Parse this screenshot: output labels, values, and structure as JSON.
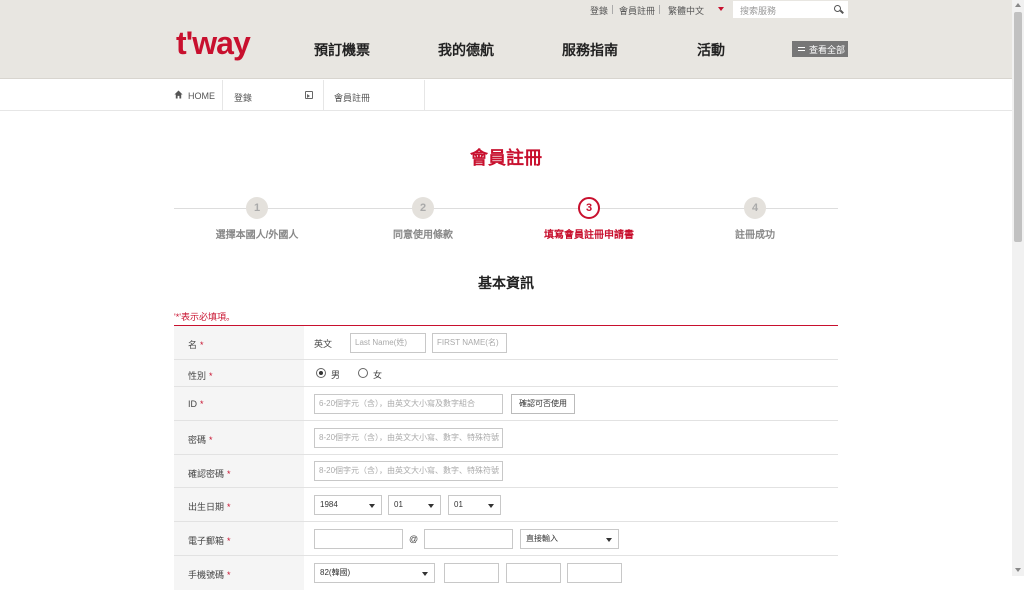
{
  "topbar": {
    "login": "登錄",
    "signup": "會員註冊",
    "language": "繁體中文",
    "search_placeholder": "搜索服務"
  },
  "header": {
    "logo": "t'way",
    "nav": [
      "預訂機票",
      "我的德航",
      "服務指南",
      "活動"
    ],
    "view_all": "查看全部"
  },
  "breadcrumb": {
    "home": "HOME",
    "level1": "登錄",
    "level2": "會員註冊"
  },
  "page_title": "會員註冊",
  "steps": [
    {
      "num": "1",
      "label": "選擇本國人/外國人",
      "active": false
    },
    {
      "num": "2",
      "label": "同意使用條款",
      "active": false
    },
    {
      "num": "3",
      "label": "填寫會員註冊申請書",
      "active": true
    },
    {
      "num": "4",
      "label": "註冊成功",
      "active": false
    }
  ],
  "section_title": "基本資訊",
  "required_note": "'*'表示必填項。",
  "form": {
    "name": {
      "label": "名",
      "prefix": "英文",
      "last_placeholder": "Last Name(姓)",
      "first_placeholder": "FIRST NAME(名)"
    },
    "gender": {
      "label": "性別",
      "male": "男",
      "female": "女",
      "selected": "男"
    },
    "id": {
      "label": "ID",
      "placeholder": "6-20個字元（含），由英文大小寫及數字組合",
      "check_button": "確認可否使用"
    },
    "password": {
      "label": "密碼",
      "placeholder": "8-20個字元（含），由英文大小寫、數字、特殊符號"
    },
    "password_confirm": {
      "label": "確認密碼",
      "placeholder": "8-20個字元（含），由英文大小寫、數字、特殊符號"
    },
    "birth": {
      "label": "出生日期",
      "year": "1984",
      "month": "01",
      "day": "01"
    },
    "email": {
      "label": "電子郵箱",
      "at": "@",
      "domain_select": "直接輸入"
    },
    "mobile": {
      "label": "手機號碼",
      "country": "82(韓國)"
    }
  },
  "colors": {
    "brand": "#c8102e",
    "header_bg": "#e8e6e1"
  }
}
